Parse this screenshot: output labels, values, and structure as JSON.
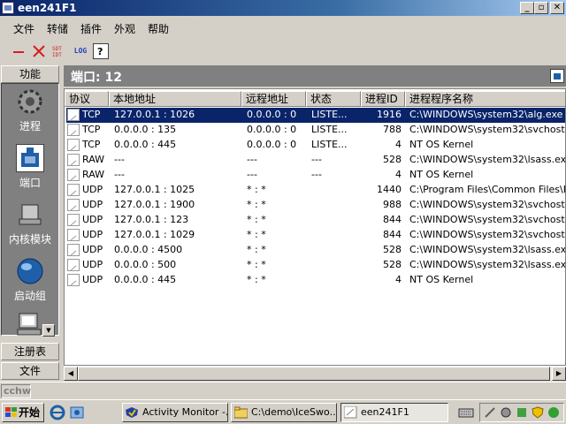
{
  "window": {
    "title": "een241F1"
  },
  "menu": [
    "文件",
    "转储",
    "插件",
    "外观",
    "帮助"
  ],
  "toolbar": {
    "log_label": "LOG"
  },
  "sidebar": {
    "top_label": "功能",
    "items": [
      {
        "label": "进程"
      },
      {
        "label": "端口"
      },
      {
        "label": "内核模块"
      },
      {
        "label": "启动组"
      }
    ],
    "bottom_buttons": [
      "注册表",
      "文件"
    ]
  },
  "panel": {
    "title": "端口: 12"
  },
  "columns": [
    "协议",
    "本地地址",
    "远程地址",
    "状态",
    "进程ID",
    "进程程序名称"
  ],
  "rows": [
    {
      "proto": "TCP",
      "local": "127.0.0.1 : 1026",
      "remote": "0.0.0.0 : 0",
      "state": "LISTE...",
      "pid": "1916",
      "path": "C:\\WINDOWS\\system32\\alg.exe"
    },
    {
      "proto": "TCP",
      "local": "0.0.0.0 : 135",
      "remote": "0.0.0.0 : 0",
      "state": "LISTE...",
      "pid": "788",
      "path": "C:\\WINDOWS\\system32\\svchost.exe"
    },
    {
      "proto": "TCP",
      "local": "0.0.0.0 : 445",
      "remote": "0.0.0.0 : 0",
      "state": "LISTE...",
      "pid": "4",
      "path": "NT OS Kernel"
    },
    {
      "proto": "RAW",
      "local": "---",
      "remote": "---",
      "state": "---",
      "pid": "528",
      "path": "C:\\WINDOWS\\system32\\lsass.exe"
    },
    {
      "proto": "RAW",
      "local": "---",
      "remote": "---",
      "state": "---",
      "pid": "4",
      "path": "NT OS Kernel"
    },
    {
      "proto": "UDP",
      "local": "127.0.0.1 : 1025",
      "remote": "* : *",
      "state": "",
      "pid": "1440",
      "path": "C:\\Program Files\\Common Files\\PFSh"
    },
    {
      "proto": "UDP",
      "local": "127.0.0.1 : 1900",
      "remote": "* : *",
      "state": "",
      "pid": "988",
      "path": "C:\\WINDOWS\\system32\\svchost.exe"
    },
    {
      "proto": "UDP",
      "local": "127.0.0.1 : 123",
      "remote": "* : *",
      "state": "",
      "pid": "844",
      "path": "C:\\WINDOWS\\system32\\svchost.exe"
    },
    {
      "proto": "UDP",
      "local": "127.0.0.1 : 1029",
      "remote": "* : *",
      "state": "",
      "pid": "844",
      "path": "C:\\WINDOWS\\system32\\svchost.exe"
    },
    {
      "proto": "UDP",
      "local": "0.0.0.0 : 4500",
      "remote": "* : *",
      "state": "",
      "pid": "528",
      "path": "C:\\WINDOWS\\system32\\lsass.exe"
    },
    {
      "proto": "UDP",
      "local": "0.0.0.0 : 500",
      "remote": "* : *",
      "state": "",
      "pid": "528",
      "path": "C:\\WINDOWS\\system32\\lsass.exe"
    },
    {
      "proto": "UDP",
      "local": "0.0.0.0 : 445",
      "remote": "* : *",
      "state": "",
      "pid": "4",
      "path": "NT OS Kernel"
    }
  ],
  "statusbar": {
    "text": "cchw"
  },
  "taskbar": {
    "start": "开始",
    "tasks": [
      {
        "label": "Activity Monitor -..."
      },
      {
        "label": "C:\\demo\\IceSwo..."
      },
      {
        "label": "een241F1"
      }
    ]
  },
  "colors": {
    "selection": "#0a246a",
    "titlebar": "#0a246a",
    "panel_head": "#808080"
  }
}
